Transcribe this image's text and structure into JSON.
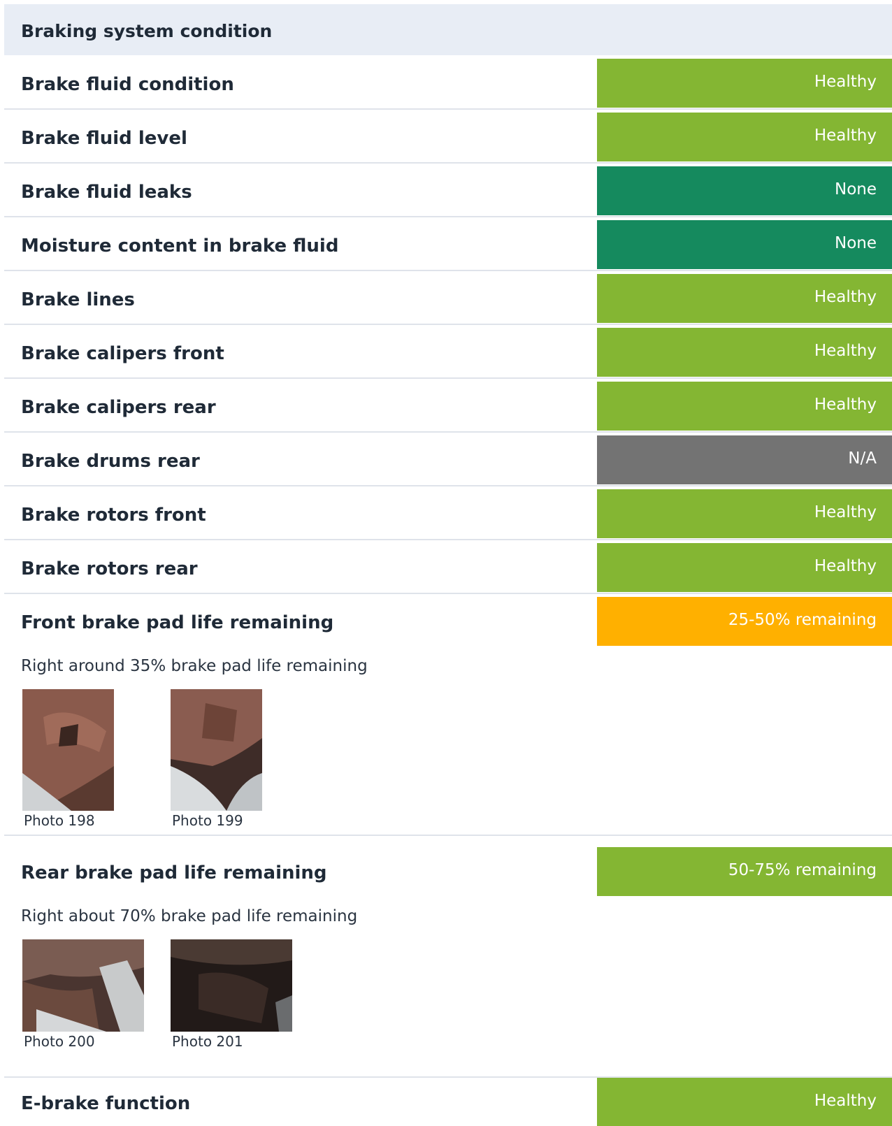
{
  "colors": {
    "healthy": "#84b633",
    "none": "#158a5e",
    "na": "#737373",
    "warning": "#ffb000"
  },
  "section": {
    "title": "Braking system condition"
  },
  "rows": [
    {
      "label": "Brake fluid condition",
      "status": "Healthy",
      "color": "#84b633"
    },
    {
      "label": "Brake fluid level",
      "status": "Healthy",
      "color": "#84b633"
    },
    {
      "label": "Brake fluid leaks",
      "status": "None",
      "color": "#158a5e"
    },
    {
      "label": "Moisture content in brake fluid",
      "status": "None",
      "color": "#158a5e"
    },
    {
      "label": "Brake lines",
      "status": "Healthy",
      "color": "#84b633"
    },
    {
      "label": "Brake calipers front",
      "status": "Healthy",
      "color": "#84b633"
    },
    {
      "label": "Brake calipers rear",
      "status": "Healthy",
      "color": "#84b633"
    },
    {
      "label": "Brake drums rear",
      "status": "N/A",
      "color": "#737373"
    },
    {
      "label": "Brake rotors front",
      "status": "Healthy",
      "color": "#84b633"
    },
    {
      "label": "Brake rotors rear",
      "status": "Healthy",
      "color": "#84b633"
    }
  ],
  "front_pads": {
    "label": "Front brake pad life remaining",
    "status": "25-50% remaining",
    "color": "#ffb000",
    "note": "Right around 35% brake pad life remaining",
    "photos": [
      {
        "caption": "Photo 198"
      },
      {
        "caption": "Photo 199"
      }
    ]
  },
  "rear_pads": {
    "label": "Rear brake pad life remaining",
    "status": "50-75% remaining",
    "color": "#84b633",
    "note": "Right about 70% brake pad life remaining",
    "photos": [
      {
        "caption": "Photo 200"
      },
      {
        "caption": "Photo 201"
      }
    ]
  },
  "ebrake": {
    "label": "E-brake function",
    "status": "Healthy",
    "color": "#84b633"
  }
}
